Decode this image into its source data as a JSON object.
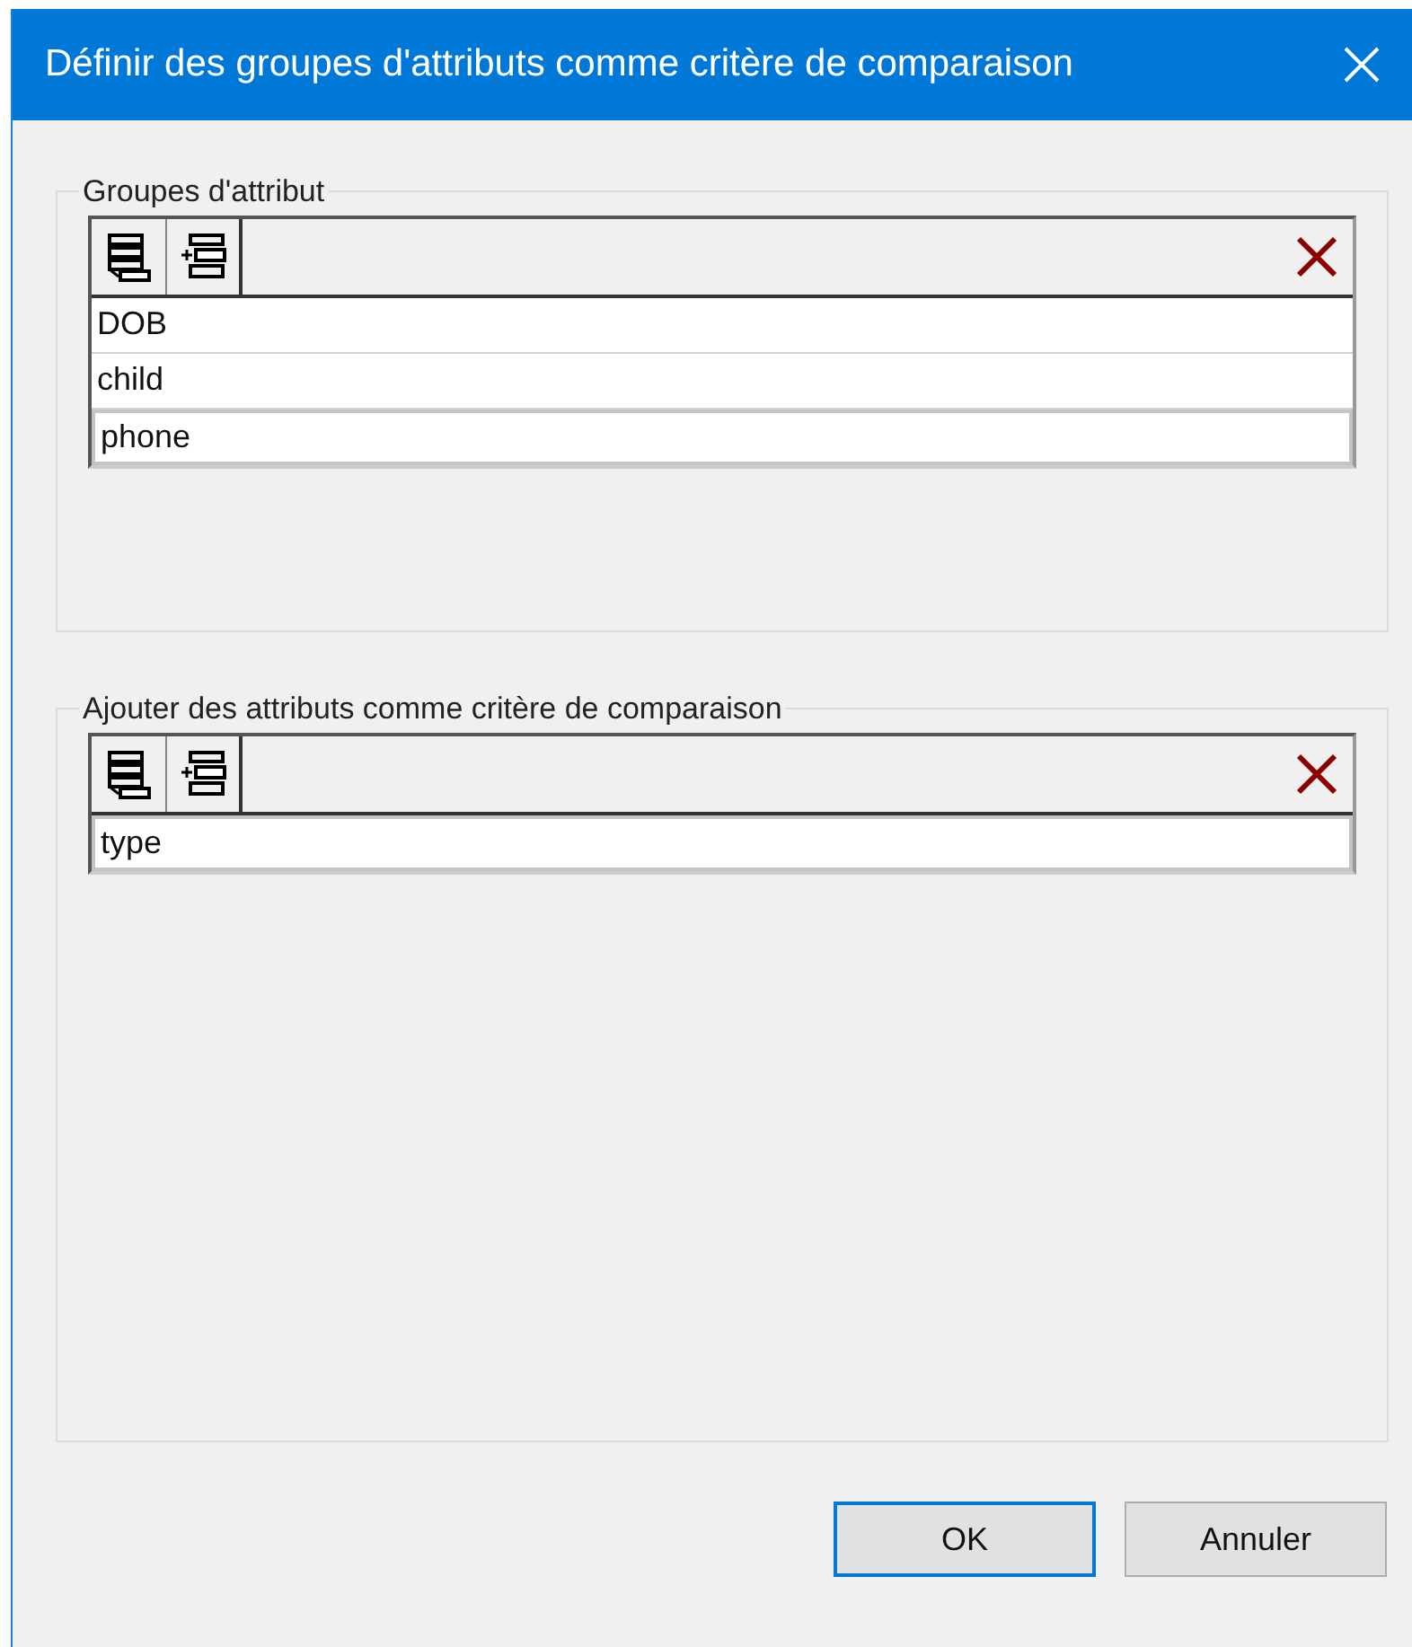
{
  "window": {
    "title": "Définir des groupes d'attributs comme critère de comparaison"
  },
  "groups": [
    {
      "label": "Groupes d'attribut",
      "rows": [
        {
          "text": "DOB",
          "selected": false
        },
        {
          "text": "child",
          "selected": false
        },
        {
          "text": "phone",
          "selected": true
        }
      ]
    },
    {
      "label": "Ajouter des attributs comme critère de comparaison",
      "rows": [
        {
          "text": "type",
          "selected": true
        }
      ]
    }
  ],
  "buttons": [
    {
      "label": "OK",
      "default": true
    },
    {
      "label": "Annuler",
      "default": false
    }
  ]
}
